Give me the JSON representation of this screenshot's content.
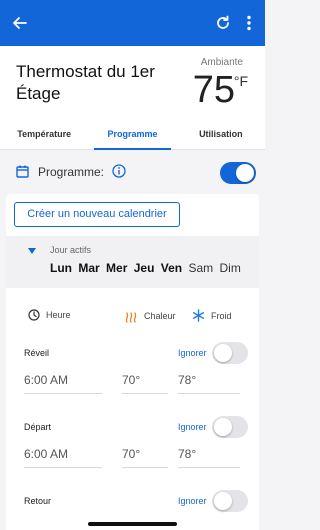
{
  "colors": {
    "primary": "#1266d8",
    "heat": "#e8841d",
    "cool": "#1f7fe0"
  },
  "appbar": {
    "back_icon": "arrow-left-icon",
    "refresh_icon": "refresh-icon",
    "more_icon": "more-vertical-icon"
  },
  "header": {
    "title": "Thermostat du 1er Étage",
    "ambient_label": "Ambiante",
    "ambient_value": "75",
    "ambient_unit": "°F"
  },
  "tabs": [
    {
      "label": "Température",
      "active": false
    },
    {
      "label": "Programme",
      "active": true
    },
    {
      "label": "Utilisation",
      "active": false
    }
  ],
  "programme": {
    "label": "Programme:",
    "enabled": true
  },
  "create_button": "Créer un nouveau calendrier",
  "active_days": {
    "label": "Jour actifs",
    "days": [
      {
        "name": "Lun",
        "active": true
      },
      {
        "name": "Mar",
        "active": true
      },
      {
        "name": "Mer",
        "active": true
      },
      {
        "name": "Jeu",
        "active": true
      },
      {
        "name": "Ven",
        "active": true
      },
      {
        "name": "Sam",
        "active": false
      },
      {
        "name": "Dim",
        "active": false
      }
    ]
  },
  "legend": {
    "time": "Heure",
    "heat": "Chaleur",
    "cool": "Froid"
  },
  "periods": [
    {
      "name": "Réveil",
      "ignore": "Ignorer",
      "ignored": false,
      "time": "6:00 AM",
      "heat": "70°",
      "cool": "78°"
    },
    {
      "name": "Départ",
      "ignore": "Ignorer",
      "ignored": false,
      "time": "6:00 AM",
      "heat": "70°",
      "cool": "78°"
    },
    {
      "name": "Retour",
      "ignore": "Ignorer",
      "ignored": false
    }
  ]
}
